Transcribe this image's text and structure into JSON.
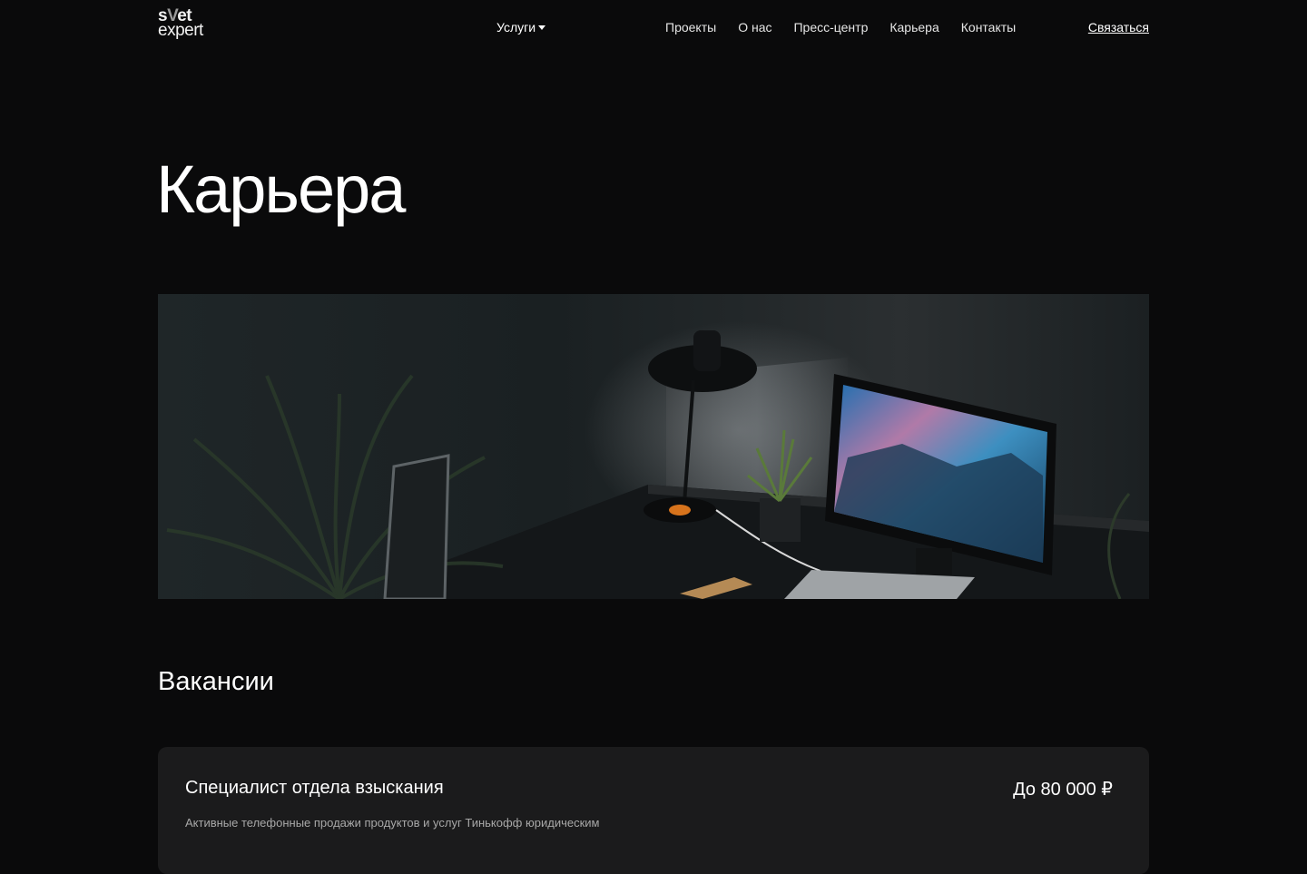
{
  "header": {
    "logo": {
      "line1_start": "s",
      "line1_accent": "V",
      "line1_end": "et",
      "line2": "expert"
    },
    "services_label": "Услуги",
    "nav": [
      "Проекты",
      "О нас",
      "Пресс-центр",
      "Карьера",
      "Контакты"
    ],
    "contact_label": "Связаться"
  },
  "page": {
    "title": "Карьера",
    "hero_icon": "desk-workspace-photo"
  },
  "vacancies": {
    "section_title": "Вакансии",
    "items": [
      {
        "title": "Специалист отдела взыскания",
        "salary": "До 80 000 ₽",
        "description": "Активные телефонные продажи продуктов и услуг Тинькофф юридическим"
      }
    ]
  }
}
